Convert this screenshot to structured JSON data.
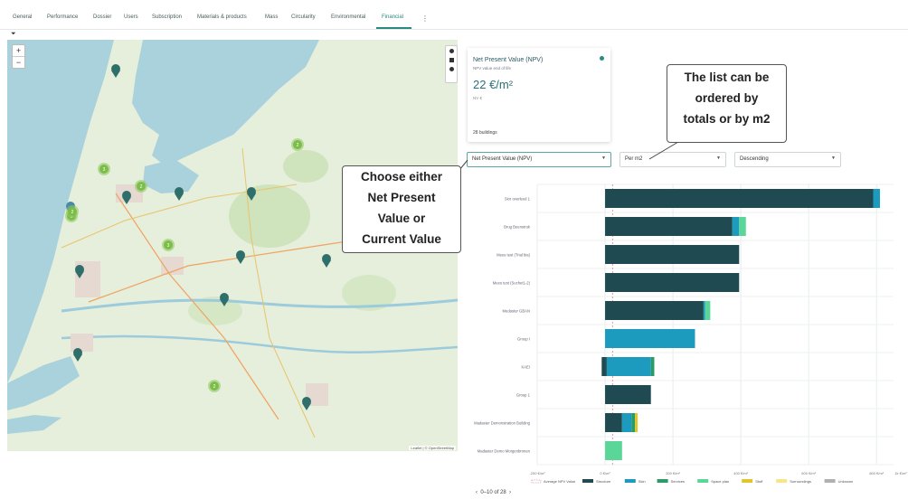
{
  "tabs": [
    {
      "label": "General"
    },
    {
      "label": "Performance"
    },
    {
      "label": "Dossier"
    },
    {
      "label": "Users"
    },
    {
      "label": "Subscription"
    },
    {
      "label": "Materials & products"
    },
    {
      "label": "Mass"
    },
    {
      "label": "Circularity"
    },
    {
      "label": "Environmental"
    },
    {
      "label": "Financial",
      "active": true
    }
  ],
  "map": {
    "zoom_in": "+",
    "zoom_out": "−",
    "attribution": "Leaflet | © OpenStreetMap",
    "clusters": [
      "2",
      "3",
      "2",
      "3",
      "3",
      "2",
      "2"
    ]
  },
  "npv_card": {
    "title": "Net Present Value (NPV)",
    "subtitle": "NPV value end of life",
    "value": "22 €/m²",
    "unit": "NV €",
    "buildings": "28 buildings"
  },
  "dropdowns": {
    "metric": "Net Present Value (NPV)",
    "per": "Per m2",
    "order": "Descending"
  },
  "callouts": {
    "ordering": [
      "The list can be",
      "ordered by",
      "totals or by m2"
    ],
    "choose": [
      "Choose either",
      "Net Present",
      "Value or",
      "Current Value"
    ]
  },
  "chart_data": {
    "type": "bar",
    "orientation": "horizontal",
    "stacked": true,
    "categories": [
      "Sior overleed 1",
      "Brug Beenstruk",
      "Mees test (Trial bia)",
      "Mees test (Suchet1-2)",
      "Medaster GBAN",
      "Group I",
      "KAEI",
      "Group 1",
      "Madaster Demonstration Building",
      "Madaster Demo Morgenbronen"
    ],
    "series": [
      {
        "name": "Structure",
        "color": "#1f4a52",
        "values": [
          790,
          375,
          395,
          395,
          290,
          0,
          5,
          135,
          50,
          0
        ]
      },
      {
        "name": "Skin",
        "color": "#1c9bbf",
        "values": [
          20,
          20,
          0,
          0,
          5,
          265,
          130,
          0,
          28,
          0
        ]
      },
      {
        "name": "Services",
        "color": "#2a9a66",
        "values": [
          0,
          0,
          0,
          0,
          0,
          0,
          10,
          0,
          10,
          0
        ]
      },
      {
        "name": "Space plan",
        "color": "#5bd699",
        "values": [
          0,
          20,
          0,
          0,
          15,
          0,
          0,
          0,
          0,
          50
        ]
      },
      {
        "name": "Stuff",
        "color": "#e0c62a",
        "values": [
          0,
          0,
          0,
          0,
          0,
          0,
          0,
          0,
          8,
          0
        ]
      },
      {
        "name": "Surroundings",
        "color": "#f7e58a",
        "values": [
          0,
          0,
          0,
          0,
          0,
          0,
          0,
          0,
          0,
          0
        ]
      },
      {
        "name": "Unknown",
        "color": "#b0b0b0",
        "values": [
          0,
          0,
          0,
          0,
          0,
          0,
          0,
          0,
          0,
          0
        ]
      }
    ],
    "negatives": [
      0,
      0,
      0,
      0,
      0,
      0,
      -10,
      0,
      0,
      0
    ],
    "average_label": "Average NPV Value",
    "average": 22,
    "xlim": [
      -200,
      850
    ],
    "xticks": [
      -200,
      0,
      200,
      400,
      600,
      800
    ],
    "xtick_labels": [
      "-200 €/m²",
      "0 €/m²",
      "200 €/m²",
      "400 €/m²",
      "600 €/m²",
      "800 €/m²"
    ],
    "x_end_label": "1k €/m²",
    "grid": true,
    "legend": "bottom"
  },
  "pager": {
    "prev": "‹",
    "text": "0–10 of 28",
    "next": "›"
  }
}
